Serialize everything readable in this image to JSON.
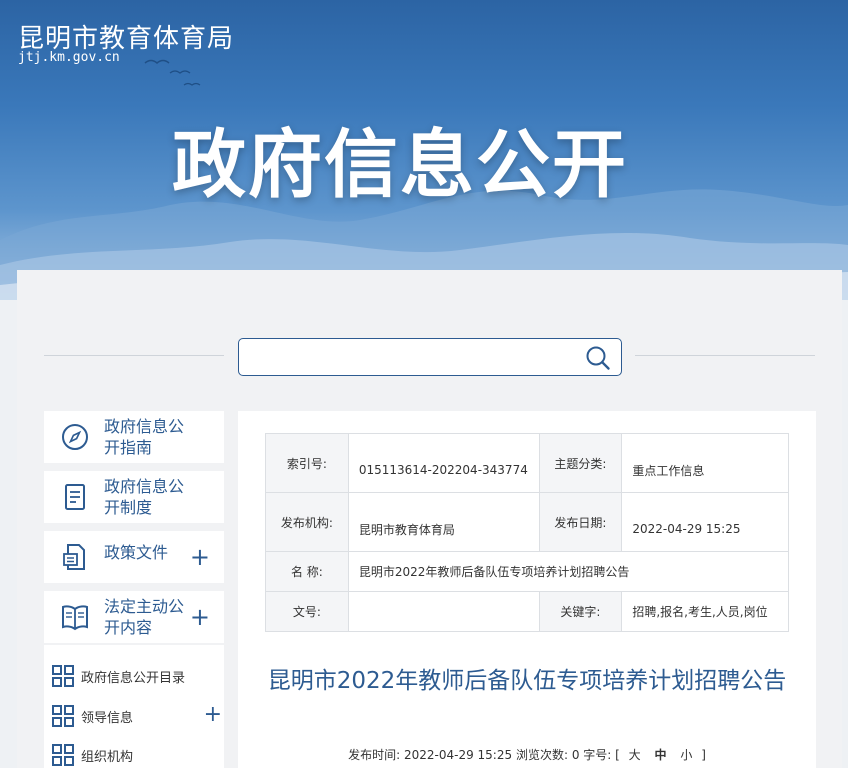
{
  "header": {
    "site_name": "昆明市教育体育局",
    "domain": "jtj.km.gov.cn",
    "hero_title": "政府信息公开"
  },
  "search": {
    "value": "",
    "placeholder": ""
  },
  "sidebar": {
    "items": [
      {
        "label": "政府信息公开指南",
        "icon": "compass-icon",
        "expandable": false
      },
      {
        "label": "政府信息公开制度",
        "icon": "document-icon",
        "expandable": false
      },
      {
        "label": "政策文件",
        "icon": "policy-file-icon",
        "expandable": true
      },
      {
        "label": "法定主动公开内容",
        "icon": "book-icon",
        "expandable": true
      }
    ],
    "sub_items": [
      {
        "label": "政府信息公开目录",
        "icon": "grid-icon",
        "expandable": false
      },
      {
        "label": "领导信息",
        "icon": "grid-icon",
        "expandable": true
      },
      {
        "label": "组织机构",
        "icon": "grid-icon",
        "expandable": false
      }
    ],
    "plus": "+"
  },
  "meta": {
    "index_label": "索引号:",
    "index_value": "015113614-202204-343774",
    "category_label": "主题分类:",
    "category_value": "重点工作信息",
    "publisher_label": "发布机构:",
    "publisher_value": "昆明市教育体育局",
    "date_label": "发布日期:",
    "date_value": "2022-04-29 15:25",
    "name_label": "名  称:",
    "name_value": "昆明市2022年教师后备队伍专项培养计划招聘公告",
    "docno_label": "文号:",
    "docno_value": "",
    "keywords_label": "关键字:",
    "keywords_value": "招聘,报名,考生,人员,岗位"
  },
  "article": {
    "title": "昆明市2022年教师后备队伍专项培养计划招聘公告",
    "publish_time_label": "发布时间:",
    "publish_time": "2022-04-29 15:25",
    "views_label": "浏览次数:",
    "views": "0",
    "font_size_label": "字号:",
    "bracket_open": "[",
    "bracket_close": "]",
    "font_large": "大",
    "font_medium": "中",
    "font_small": "小"
  },
  "colors": {
    "accent": "#2d5b91",
    "banner": "#3a78ba",
    "panel": "#f1f2f4"
  }
}
